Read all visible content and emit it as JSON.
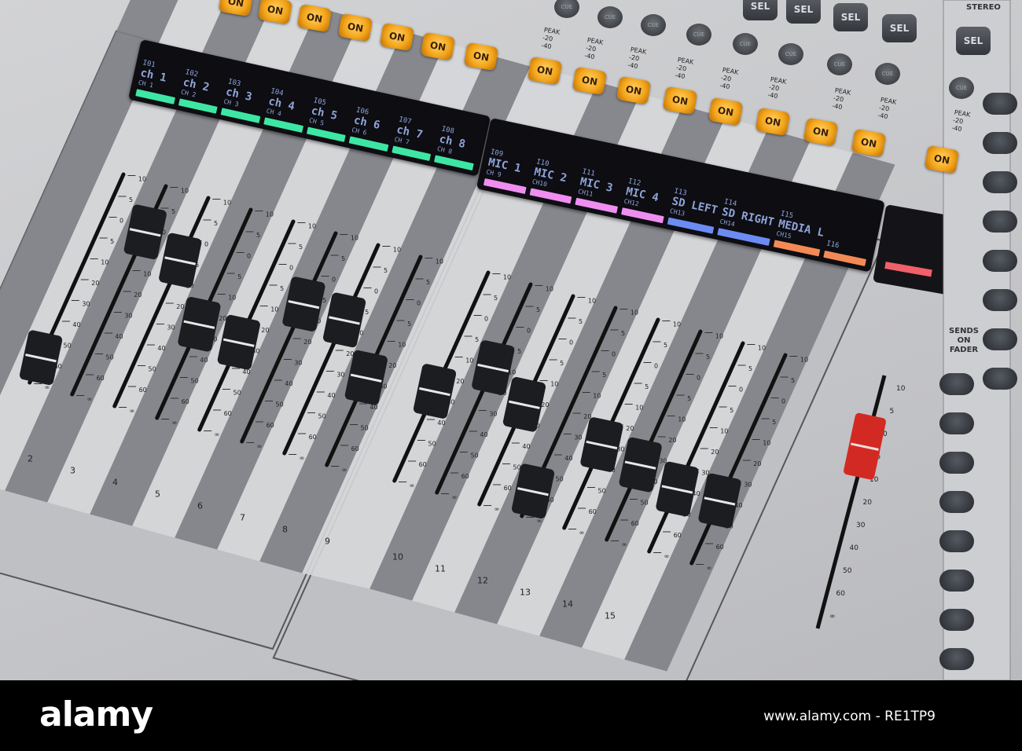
{
  "lcd_left": [
    {
      "input": "I01",
      "name": "ch 1",
      "channel": "CH 1"
    },
    {
      "input": "I02",
      "name": "ch 2",
      "channel": "CH 2"
    },
    {
      "input": "I03",
      "name": "ch 3",
      "channel": "CH 3"
    },
    {
      "input": "I04",
      "name": "ch 4",
      "channel": "CH 4"
    },
    {
      "input": "I05",
      "name": "ch 5",
      "channel": "CH 5"
    },
    {
      "input": "I06",
      "name": "ch 6",
      "channel": "CH 6"
    },
    {
      "input": "I07",
      "name": "ch 7",
      "channel": "CH 7"
    },
    {
      "input": "I08",
      "name": "ch 8",
      "channel": "CH 8"
    }
  ],
  "lcd_right": [
    {
      "input": "I09",
      "name": "MIC 1",
      "channel": "CH 9"
    },
    {
      "input": "I10",
      "name": "MIC 2",
      "channel": "CH10"
    },
    {
      "input": "I11",
      "name": "MIC 3",
      "channel": "CH11"
    },
    {
      "input": "I12",
      "name": "MIC 4",
      "channel": "CH12"
    },
    {
      "input": "I13",
      "name": "SD LEFT",
      "channel": "CH13"
    },
    {
      "input": "I14",
      "name": "SD RIGHT",
      "channel": "CH14"
    },
    {
      "input": "I15",
      "name": "MEDIA L",
      "channel": "CH15"
    },
    {
      "input": "I16",
      "name": "",
      "channel": ""
    }
  ],
  "colors": {
    "green": "#3ee6a4",
    "pink": "#ef8ef0",
    "blue": "#6b8cf2",
    "orange": "#f38a55",
    "stereo_bar": "#f0606a",
    "on": "#f3a51a",
    "stereo_cap": "#d22a22"
  },
  "lcd_right_colors": [
    "pink",
    "pink",
    "pink",
    "pink",
    "blue",
    "blue",
    "orange",
    "orange"
  ],
  "on_label": "ON",
  "cue_label": "CUE",
  "sel_label": "SEL",
  "stereo_label": "STEREO",
  "sends_label": "SENDS ON FADER",
  "meter": {
    "peak": "PEAK",
    "m20": "-20",
    "m40": "-40"
  },
  "scale": [
    "10",
    "5",
    "0",
    "5",
    "10",
    "20",
    "30",
    "40",
    "50",
    "60",
    "∞"
  ],
  "strip_numbers": [
    "2",
    "3",
    "4",
    "5",
    "6",
    "7",
    "8",
    "9",
    "10",
    "11",
    "12",
    "13",
    "14",
    "15"
  ],
  "fader_levels": [
    0.12,
    0.78,
    0.7,
    0.45,
    0.42,
    0.66,
    0.64,
    0.42,
    0.43,
    0.6,
    0.48,
    0.12,
    0.4,
    0.36,
    0.3,
    0.3
  ],
  "stereo_level": 0.72,
  "watermark": {
    "logo": "alamy",
    "id": "www.alamy.com - RE1TP9"
  }
}
